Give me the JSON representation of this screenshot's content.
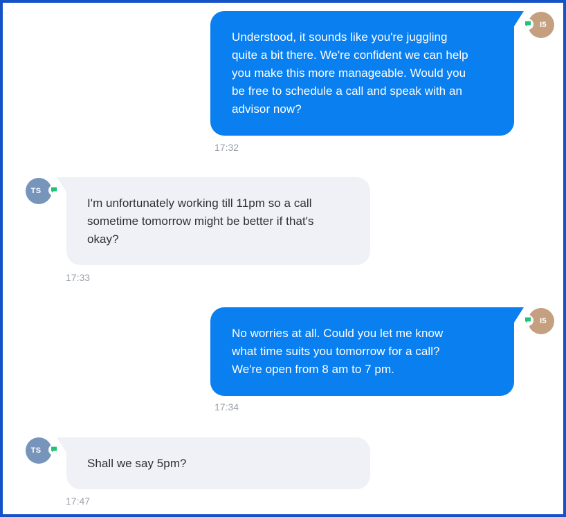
{
  "messages": [
    {
      "sender": "agent",
      "initials": "I5",
      "text": "Understood, it sounds like you're juggling\nquite a bit there. We're confident we can help\nyou make this more manageable. Would you\nbe free to schedule a call and speak with an\nadvisor now?",
      "time": "17:32"
    },
    {
      "sender": "user",
      "initials": "TS",
      "text": "I'm unfortunately working till 11pm so a call\nsometime tomorrow might be better if that's\nokay?",
      "time": "17:33"
    },
    {
      "sender": "agent",
      "initials": "I5",
      "text": "No worries at all. Could you let me know\nwhat time suits you tomorrow for a call?\nWe're open from 8 am to 7 pm.",
      "time": "17:34"
    },
    {
      "sender": "user",
      "initials": "TS",
      "text": "Shall we say 5pm?",
      "time": "17:47"
    }
  ],
  "icons": {
    "channel": "chat-bubble-icon"
  },
  "colors": {
    "frame_border": "#1652c7",
    "outgoing_bubble": "#0a7ff0",
    "incoming_bubble": "#eff1f6",
    "agent_avatar": "#c4a081",
    "user_avatar": "#7794bb",
    "channel_icon": "#1fc47a",
    "timestamp": "#9aa0a8"
  }
}
